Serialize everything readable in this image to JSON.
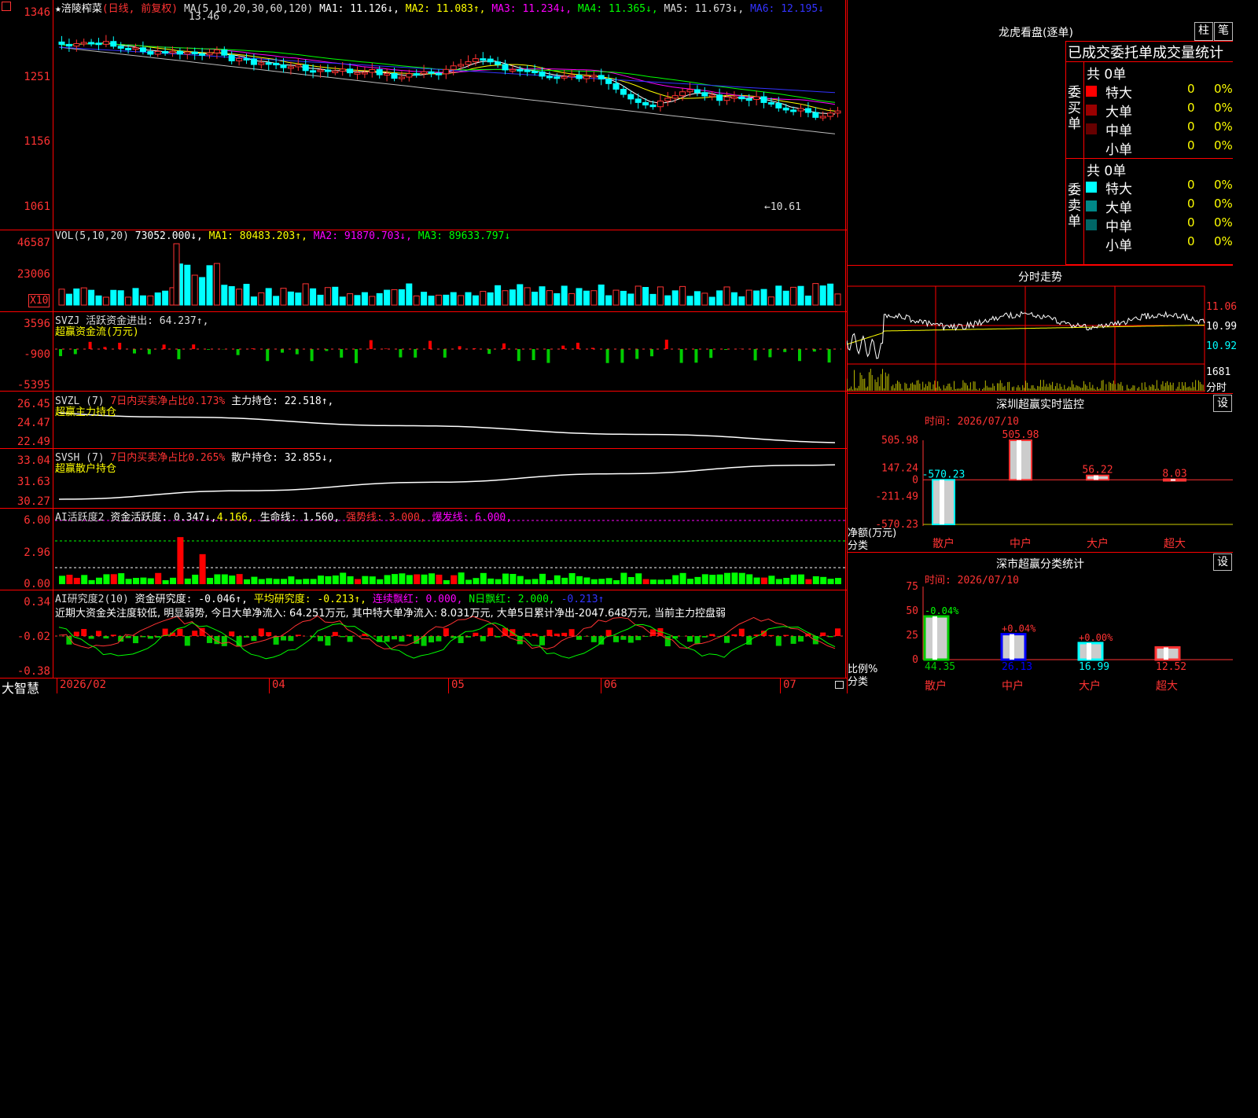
{
  "main": {
    "stock_name": "★涪陵榨菜",
    "mode": "(日线, 前复权)",
    "ma_prefix": "MA(5,10,20,30,60,120)",
    "ma": [
      {
        "label": "MA1: 11.126↓,",
        "color": "#ffffff"
      },
      {
        "label": "MA2: 11.083↑,",
        "color": "#ffff00"
      },
      {
        "label": "MA3: 11.234↓,",
        "color": "#ff00ff"
      },
      {
        "label": "MA4: 11.365↓,",
        "color": "#00ff00"
      },
      {
        "label": "MA5: 11.673↓,",
        "color": "#dddddd"
      },
      {
        "label": "MA6: 12.195↓",
        "color": "#3333ff"
      }
    ],
    "y_ticks": [
      "1346",
      "1251",
      "1156",
      "1061"
    ],
    "high_mark": "13.46",
    "low_mark": "←10.61"
  },
  "vol": {
    "prefix": "VOL(5,10,20)",
    "value": "73052.000↓,",
    "ma": [
      {
        "label": "MA1: 80483.203↑,",
        "color": "#ffff00"
      },
      {
        "label": "MA2: 91870.703↓,",
        "color": "#ff00ff"
      },
      {
        "label": "MA3: 89633.797↓",
        "color": "#00ff00"
      }
    ],
    "y_ticks": [
      "46587",
      "23006"
    ],
    "unit": "X10"
  },
  "svzj": {
    "line1": "SVZJ  活跃资金进出: 64.237↑,",
    "line2": "超赢资金流(万元)",
    "y_ticks": [
      "3596",
      "-900",
      "-5395"
    ]
  },
  "svzl": {
    "prefix": "SVZL (7)",
    "ratio": "7日内买卖净占比0.173%",
    "hold": "主力持仓: 22.518↑,",
    "line2": "超赢主力持仓",
    "y_ticks": [
      "26.45",
      "24.47",
      "22.49"
    ]
  },
  "svsh": {
    "prefix": "SVSH (7)",
    "ratio": "7日内买卖净占比0.265%",
    "hold": "散户持仓: 32.855↓,",
    "line2": "超赢散户持仓",
    "y_ticks": [
      "33.04",
      "31.63",
      "30.27"
    ]
  },
  "ai1": {
    "prefix": "AI活跃度2",
    "v1": "资金活跃度: 0.347↓,",
    "v2": "4.166,",
    "v3": "生命线: 1.560,",
    "v4": "强势线: 3.000,",
    "v5": "爆发线: 6.000,",
    "y_ticks": [
      "6.00",
      "2.96",
      "0.00"
    ]
  },
  "ai2": {
    "prefix": "AI研究度2(10)",
    "v1": "资金研究度: -0.046↑,",
    "v2": "平均研究度: -0.213↑,",
    "v3": "连续飘红: 0.000,",
    "v4": "N日飘红: 2.000,",
    "v5": "-0.213↑",
    "comment": "近期大资金关注度较低, 明显弱势, 今日大单净流入: 64.251万元, 其中特大单净流入: 8.031万元, 大单5日累计净出-2047.648万元, 当前主力控盘弱",
    "y_ticks": [
      "0.34",
      "-0.02",
      "-0.38"
    ]
  },
  "xaxis": {
    "brand": "大智慧",
    "labels": [
      "2026/02",
      "04",
      "05",
      "06",
      "07"
    ]
  },
  "right": {
    "lhb_title": "龙虎看盘(逐单)",
    "btn_zhu": "柱",
    "btn_bi": "笔",
    "stats_title": "已成交委托单成交量统计",
    "buy_label": "委买单",
    "sell_label": "委卖单",
    "buy_total": "共 0单",
    "sell_total": "共 0单",
    "buy_rows": [
      {
        "name": "特大",
        "count": "0",
        "pct": "0%",
        "color": "#ff0000"
      },
      {
        "name": "大单",
        "count": "0",
        "pct": "0%",
        "color": "#990000"
      },
      {
        "name": "中单",
        "count": "0",
        "pct": "0%",
        "color": "#660000"
      },
      {
        "name": "小单",
        "count": "0",
        "pct": "0%",
        "color": ""
      }
    ],
    "sell_rows": [
      {
        "name": "特大",
        "count": "0",
        "pct": "0%",
        "color": "#00ffff"
      },
      {
        "name": "大单",
        "count": "0",
        "pct": "0%",
        "color": "#008888"
      },
      {
        "name": "中单",
        "count": "0",
        "pct": "0%",
        "color": "#006666"
      },
      {
        "name": "小单",
        "count": "0",
        "pct": "0%",
        "color": ""
      }
    ],
    "intraday_title": "分时走势",
    "intraday_ticks": [
      "11.06",
      "10.99",
      "10.92"
    ],
    "intraday_vol": "1681",
    "intraday_unit": "分时",
    "monitor_title": "深圳超赢实时监控",
    "monitor_btn": "设",
    "monitor_time": "时间: 2026/07/10",
    "monitor_ticks": [
      "505.98",
      "147.24",
      "0",
      "-211.49",
      "-570.23"
    ],
    "monitor_ylabel": "净额(万元)",
    "monitor_xlabel": "分类",
    "class_title": "深市超赢分类统计",
    "class_btn": "设",
    "class_time": "时间: 2026/07/10",
    "class_ticks": [
      "75",
      "50",
      "25",
      "0"
    ],
    "class_ylabel": "比例%",
    "class_xlabel": "分类"
  },
  "chart_data": [
    {
      "type": "bar",
      "title": "深圳超赢实时监控",
      "ylabel": "净额(万元)",
      "categories": [
        "散户",
        "中户",
        "大户",
        "超大"
      ],
      "values": [
        -570.23,
        505.98,
        56.22,
        8.03
      ],
      "ylim": [
        -570.23,
        505.98
      ],
      "colors": [
        "#00ffff",
        "#ff3333",
        "#ff3333",
        "#ff3333"
      ]
    },
    {
      "type": "bar",
      "title": "深市超赢分类统计",
      "ylabel": "比例%",
      "categories": [
        "散户",
        "中户",
        "大户",
        "超大"
      ],
      "values": [
        44.35,
        26.13,
        16.99,
        12.52
      ],
      "changes": [
        "-0.04%",
        "+0.04%",
        "+0.00%",
        ""
      ],
      "ylim": [
        0,
        75
      ],
      "colors": [
        "#00cc00",
        "#0000ff",
        "#00ffff",
        "#ff3333"
      ]
    }
  ]
}
